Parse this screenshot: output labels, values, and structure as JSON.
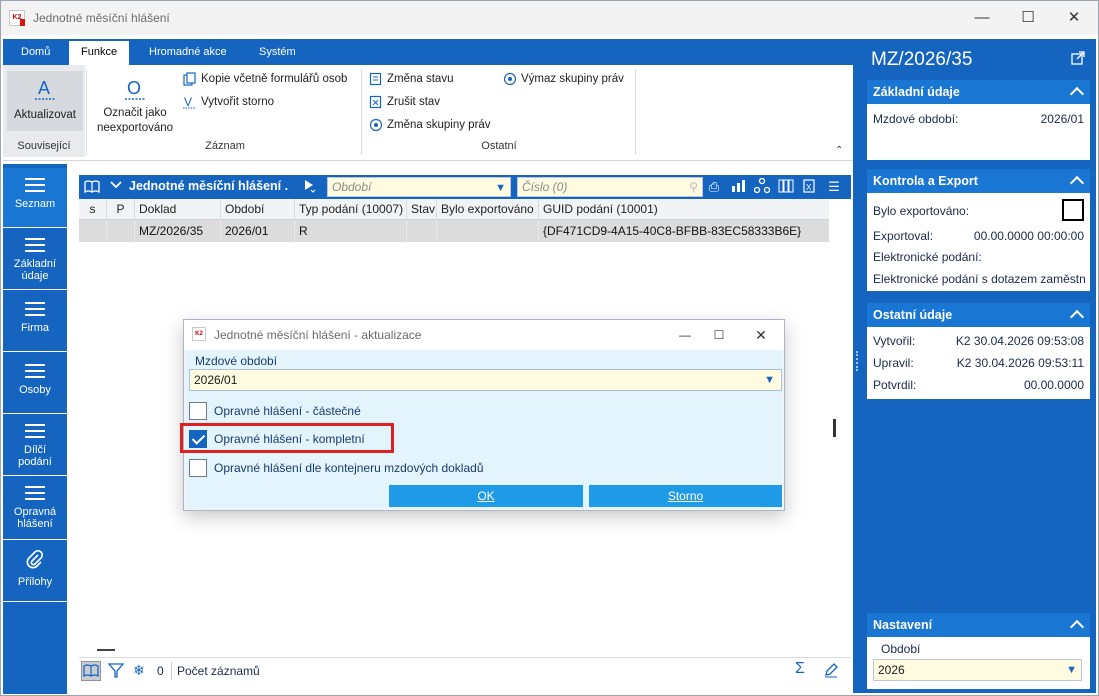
{
  "window": {
    "title": "Jednotné měsíční hlášení",
    "app_icon_text": "K2"
  },
  "ribbon": {
    "tabs": [
      "Domů",
      "Funkce",
      "Hromadné akce",
      "Systém"
    ],
    "active_tab": "Funkce",
    "groups": {
      "souvisejici": {
        "label": "Související",
        "refresh": "Aktualizovat"
      },
      "zaznam": {
        "label": "Záznam",
        "mark_line1": "Označit jako",
        "mark_line2": "neexportováno",
        "copy": "Kopie včetně formulářů osob",
        "storno": "Vytvořit storno"
      },
      "ostatni": {
        "label": "Ostatní",
        "change_state": "Změna stavu",
        "cancel_state": "Zrušit stav",
        "change_group": "Změna skupiny práv",
        "remove_group": "Výmaz skupiny práv"
      }
    }
  },
  "left_nav": {
    "items": [
      {
        "line1": "Seznam",
        "line2": ""
      },
      {
        "line1": "Základní",
        "line2": "údaje"
      },
      {
        "line1": "Firma",
        "line2": ""
      },
      {
        "line1": "Osoby",
        "line2": ""
      },
      {
        "line1": "Dílčí",
        "line2": "podání"
      },
      {
        "line1": "Opravná",
        "line2": "hlášení"
      },
      {
        "line1": "Přílohy",
        "line2": ""
      }
    ]
  },
  "grid": {
    "title": "Jednotné měsíční hlášení .",
    "filter_period_placeholder": "Období",
    "filter_number_placeholder": "Číslo (0)",
    "columns": [
      "s",
      "P",
      "Doklad",
      "Období",
      "Typ podání (10007)",
      "Stav",
      "Bylo exportováno",
      "GUID podání (10001)"
    ],
    "rows": [
      [
        "",
        "",
        "MZ/2026/35",
        "2026/01",
        "R",
        "",
        "",
        "{DF471CD9-4A15-40C8-BFBB-83EC58333B6E}"
      ]
    ],
    "status": {
      "count": "0",
      "label": "Počet záznamů",
      "sum_icon": "Σ"
    }
  },
  "right_panel": {
    "title": "MZ/2026/35",
    "sections": {
      "zakladni": {
        "title": "Základní údaje",
        "mzdove_obdobi_label": "Mzdové období:",
        "mzdove_obdobi_value": "2026/01"
      },
      "kontrola": {
        "title": "Kontrola a Export",
        "bylo_exportovano": "Bylo exportováno:",
        "exportoval_label": "Exportoval:",
        "exportoval_value": "00.00.0000 00:00:00",
        "elektronicke": "Elektronické podání:",
        "elektronicke_dotaz": "Elektronické podání s dotazem zaměstn"
      },
      "ostatni": {
        "title": "Ostatní údaje",
        "vytvoril_label": "Vytvořil:",
        "vytvoril_user": "K2",
        "vytvoril_value": "30.04.2026 09:53:08",
        "upravil_label": "Upravil:",
        "upravil_user": "K2",
        "upravil_value": "30.04.2026 09:53:11",
        "potvrdil_label": "Potvrdil:",
        "potvrdil_value": "00.00.0000"
      },
      "nastaveni": {
        "title": "Nastavení",
        "obdobi_label": "Období",
        "obdobi_value": "2026"
      }
    }
  },
  "dialog": {
    "title": "Jednotné měsíční hlášení - aktualizace",
    "period_label": "Mzdové období",
    "period_value": "2026/01",
    "options": [
      {
        "label": "Opravné hlášení - částečné",
        "checked": false
      },
      {
        "label": "Opravné hlášení - kompletní",
        "checked": true
      },
      {
        "label": "Opravné hlášení dle kontejneru mzdových dokladů",
        "checked": false
      }
    ],
    "ok": "OK",
    "cancel": "Storno"
  },
  "colors": {
    "accent": "#1565c0",
    "dialog_bg": "#e3f4fd",
    "button": "#1e9ae6",
    "highlight": "#e02020",
    "filter_bg": "#fffbe0"
  }
}
